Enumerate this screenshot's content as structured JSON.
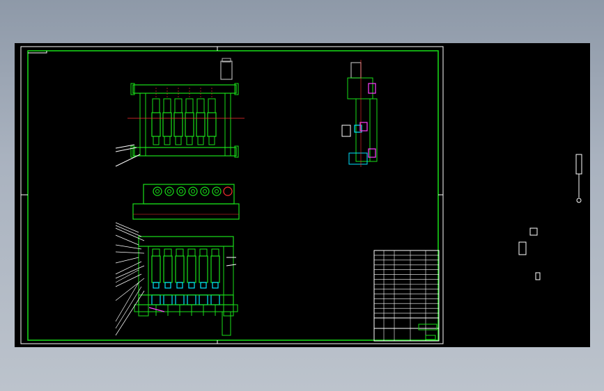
{
  "drawing": {
    "title_block_rows": 14,
    "legend_text": []
  },
  "views": [
    {
      "name": "front-view",
      "spindles": 6
    },
    {
      "name": "top-view",
      "spindles": 6
    },
    {
      "name": "section-view",
      "spindles": 6
    },
    {
      "name": "side-view"
    }
  ],
  "colors": {
    "background": "#000000",
    "frame": "#ffffff",
    "structure": "#19e019",
    "cut_plane": "#ff3030",
    "cyan": "#00e5ff",
    "magenta": "#ff40ff",
    "yellow": "#ffe000",
    "grey": "#b0b0b0"
  }
}
